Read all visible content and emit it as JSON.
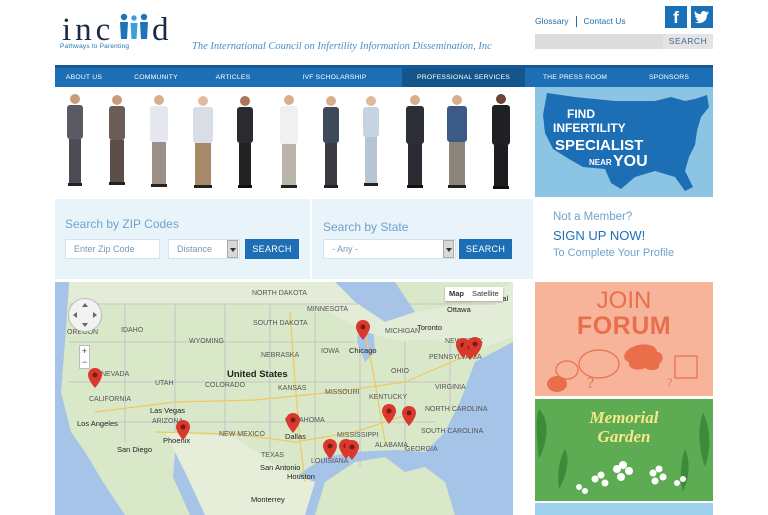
{
  "logo": {
    "text_left": "inc",
    "text_right": "d",
    "tagline": "Pathways to Parenting"
  },
  "org_name": "The International Council on Infertility Information Dissemination, Inc",
  "top_links": {
    "glossary": "Glossary",
    "contact": "Contact Us"
  },
  "social": {
    "facebook": "f",
    "twitter": "t"
  },
  "search": {
    "placeholder": "",
    "button": "SEARCH"
  },
  "nav": [
    {
      "label": "ABOUT US",
      "active": false
    },
    {
      "label": "COMMUNITY",
      "active": false
    },
    {
      "label": "ARTICLES",
      "active": false
    },
    {
      "label": "IVF SCHOLARSHIP",
      "active": false
    },
    {
      "label": "PROFESSIONAL SERVICES",
      "active": true
    },
    {
      "label": "THE PRESS ROOM",
      "active": false
    },
    {
      "label": "SPONSORS",
      "active": false
    }
  ],
  "find_panel": {
    "line1": "FIND",
    "line2": "INFERTILITY",
    "line3": "SPECIALIST",
    "near": "NEAR",
    "you": "YOU"
  },
  "zip_search": {
    "title": "Search by ZIP Codes",
    "zip_placeholder": "Enter Zip Code",
    "distance": "Distance",
    "button": "SEARCH"
  },
  "state_search": {
    "title": "Search by State",
    "state_value": "- Any -",
    "button": "SEARCH"
  },
  "member": {
    "question": "Not a Member?",
    "signup": "SIGN UP NOW!",
    "profile": "To Complete Your Profile"
  },
  "map": {
    "map_btn": "Map",
    "satellite_btn": "Satellite",
    "zoom_in": "+",
    "zoom_out": "−",
    "country": "United States",
    "states": [
      "OREGON",
      "IDAHO",
      "WYOMING",
      "NEVADA",
      "CALIFORNIA",
      "UTAH",
      "COLORADO",
      "KANSAS",
      "ARIZONA",
      "NEW MEXICO",
      "TEXAS",
      "OKLAHOMA",
      "NORTH DAKOTA",
      "SOUTH DAKOTA",
      "NEBRASKA",
      "MINNESOTA",
      "IOWA",
      "MISSOURI",
      "MICHIGAN",
      "OHIO",
      "PENNSYLVANIA",
      "NEW YORK",
      "MISSISSIPPI",
      "LOUISIANA",
      "ALABAMA",
      "GEORGIA",
      "SOUTH CAROLINA",
      "NORTH CAROLINA",
      "KENTUCKY",
      "VIRGINIA"
    ],
    "cities": [
      "Chicago",
      "Toronto",
      "Ottawa",
      "Montreal",
      "Los Angeles",
      "Las Vegas",
      "Phoenix",
      "San Diego",
      "Dallas",
      "San Antonio",
      "Houston",
      "Monterrey"
    ],
    "pin_count": 12
  },
  "join": {
    "line1": "JOIN",
    "line2": "FORUM"
  },
  "memorial": {
    "line1": "Memorial",
    "line2": "Garden"
  },
  "colors": {
    "brand_blue": "#1d6fb5",
    "nav_active": "#14558c",
    "light_blue": "#8cc4e4",
    "join_orange": "#f7b49b",
    "memorial_green": "#5dab52",
    "pin_red": "#d9382c"
  }
}
